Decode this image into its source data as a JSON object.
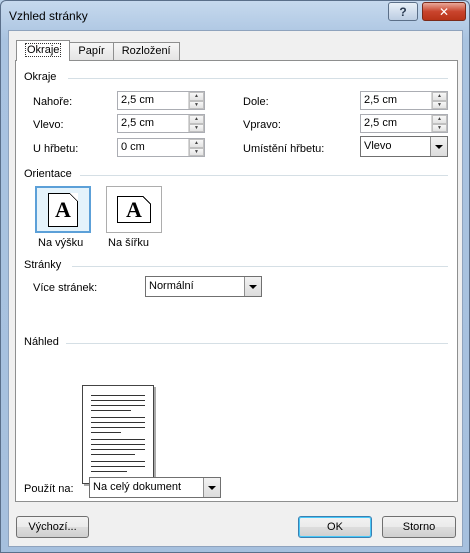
{
  "window": {
    "title": "Vzhled stránky"
  },
  "titlebar": {
    "help_label": "?",
    "close_label": "✕"
  },
  "tabs": [
    {
      "label": "Okraje"
    },
    {
      "label": "Papír"
    },
    {
      "label": "Rozložení"
    }
  ],
  "margins": {
    "group_label": "Okraje",
    "top_label": "Nahoře:",
    "top_value": "2,5 cm",
    "bottom_label": "Dole:",
    "bottom_value": "2,5 cm",
    "left_label": "Vlevo:",
    "left_value": "2,5 cm",
    "right_label": "Vpravo:",
    "right_value": "2,5 cm",
    "gutter_label": "U hřbetu:",
    "gutter_value": "0 cm",
    "gutter_pos_label": "Umístění hřbetu:",
    "gutter_pos_value": "Vlevo"
  },
  "orientation": {
    "group_label": "Orientace",
    "portrait_label": "Na výšku",
    "landscape_label": "Na šířku",
    "icon_letter": "A",
    "selected": "portrait"
  },
  "pages": {
    "group_label": "Stránky",
    "multiple_label": "Více stránek:",
    "multiple_value": "Normální"
  },
  "preview": {
    "group_label": "Náhled"
  },
  "apply": {
    "label": "Použít na:",
    "value": "Na celý dokument"
  },
  "buttons": {
    "default_label": "Výchozí...",
    "ok_label": "OK",
    "cancel_label": "Storno"
  },
  "colors": {
    "title_bg": "#a9c3e0",
    "close_button": "#c9442d",
    "selection": "#5ca0d8"
  }
}
